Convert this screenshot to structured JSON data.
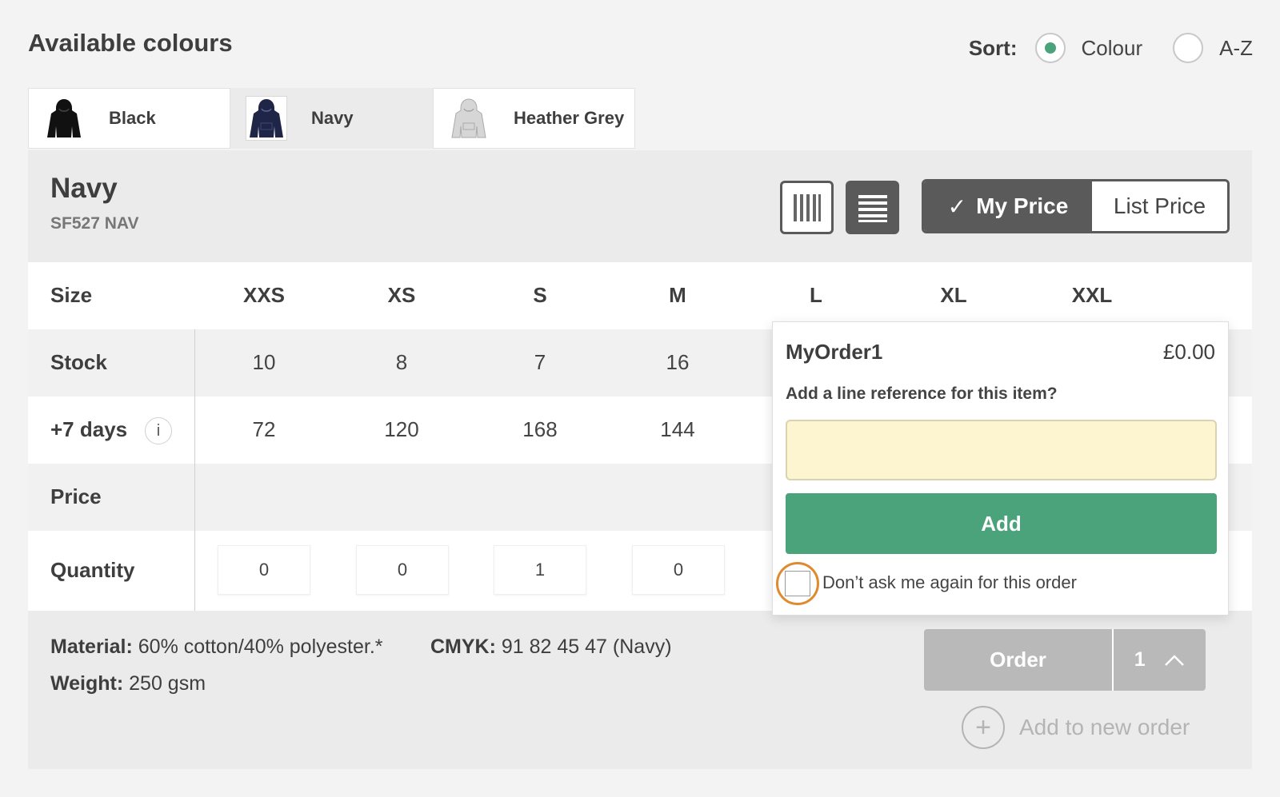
{
  "header": {
    "title": "Available colours",
    "sort_label": "Sort:",
    "sort_options": [
      "Colour",
      "A-Z"
    ],
    "sort_selected": "Colour"
  },
  "colour_tabs": [
    {
      "label": "Black",
      "color": "#111111",
      "active": false
    },
    {
      "label": "Navy",
      "color": "#1f2547",
      "active": true
    },
    {
      "label": "Heather Grey",
      "color": "#c9c9c9",
      "active": false
    }
  ],
  "product": {
    "name": "Navy",
    "code": "SF527 NAV"
  },
  "price_toggle": {
    "my_price": "My Price",
    "list_price": "List Price",
    "check": "✓"
  },
  "table": {
    "row_labels": {
      "size": "Size",
      "stock": "Stock",
      "days": "+7 days",
      "price": "Price",
      "quantity": "Quantity"
    },
    "info_icon": "i",
    "sizes": [
      "XXS",
      "XS",
      "S",
      "M",
      "L",
      "XL",
      "XXL"
    ],
    "stock": [
      "10",
      "8",
      "7",
      "16"
    ],
    "days": [
      "72",
      "120",
      "168",
      "144"
    ],
    "quantity": [
      "0",
      "0",
      "1",
      "0"
    ]
  },
  "details": {
    "material_label": "Material:",
    "material_value": "60% cotton/40% polyester.*",
    "cmyk_label": "CMYK:",
    "cmyk_value": "91 82 45 47 (Navy)",
    "weight_label": "Weight:",
    "weight_value": "250 gsm"
  },
  "order": {
    "button": "Order",
    "count": "1",
    "add_new": "Add to new order"
  },
  "popup": {
    "title": "MyOrder1",
    "total": "£0.00",
    "question": "Add a line reference for this item?",
    "input_value": "",
    "add_button": "Add",
    "dont_ask": "Don’t ask me again for this order"
  },
  "colors": {
    "accent": "#4aa37b",
    "focus_ring": "#e08a30",
    "dark_button": "#5a5a5a",
    "input_bg": "#fdf5cf"
  }
}
